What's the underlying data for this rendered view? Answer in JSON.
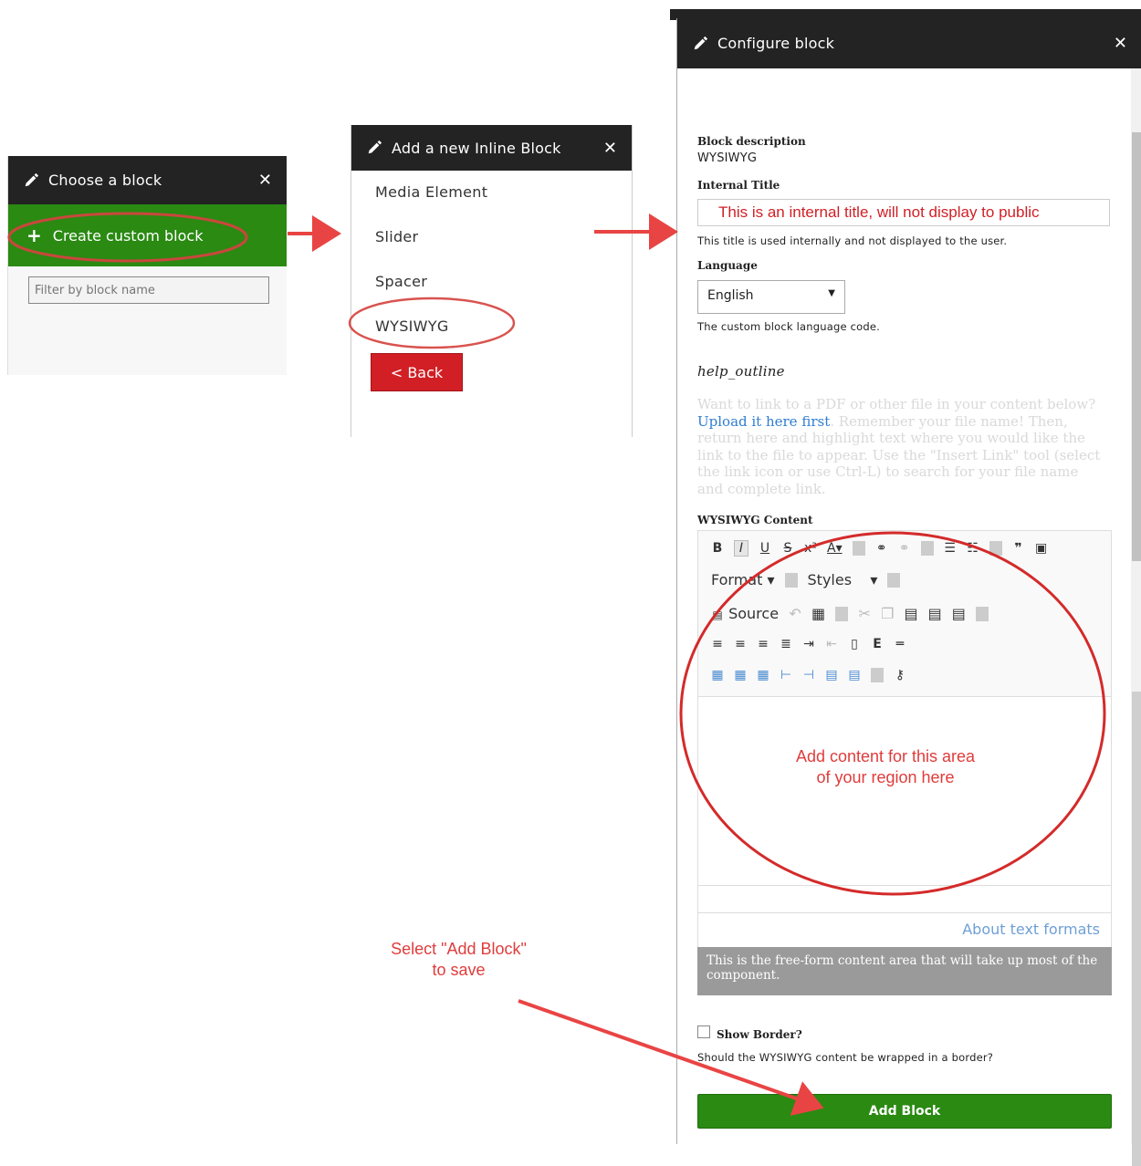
{
  "panel1": {
    "title": "Choose a block",
    "close": "✕",
    "create_label": "Create custom block",
    "filter_placeholder": "Filter by block name"
  },
  "panel2": {
    "title": "Add a new Inline Block",
    "close": "✕",
    "items": [
      "Media Element",
      "Slider",
      "Spacer",
      "WYSIWYG"
    ],
    "back_label": "< Back"
  },
  "panel3": {
    "title": "Configure block",
    "close": "✕",
    "block_description_label": "Block description",
    "block_description_value": "WYSIWYG",
    "internal_title_label": "Internal Title",
    "internal_title_value": "This is an internal title, will not display to public",
    "internal_title_help": "This title is used internally and not displayed to the user.",
    "language_label": "Language",
    "language_value": "English",
    "language_help": "The custom block language code.",
    "help_outline": "help_outline",
    "help_text_1": "Want to link to a PDF or other file in your content below?",
    "help_link": "Upload it here first",
    "help_text_2": ". Remember your file name! Then, return here and highlight text where you would like the link to the file to appear. Use the \"Insert Link\" tool (select the link icon or use Ctrl-L) to search for your file name and complete link.",
    "wysiwyg_label": "WYSIWYG Content",
    "format_label": "Format",
    "styles_label": "Styles",
    "source_label": "Source",
    "about_formats": "About text formats",
    "component_desc": "This is the free-form content area that will take up most of the component.",
    "show_border_label": "Show Border?",
    "show_border_help": "Should the WYSIWYG content be wrapped in a border?",
    "add_block_label": "Add Block"
  },
  "annotations": {
    "content_note_line1": "Add content for this area",
    "content_note_line2": "of your region here",
    "save_note_line1": "Select \"Add Block\"",
    "save_note_line2": "to save"
  },
  "colors": {
    "header_bg": "#232323",
    "green": "#2a8a12",
    "red_button": "#d11f25",
    "annotation_red": "#e03c3c"
  }
}
